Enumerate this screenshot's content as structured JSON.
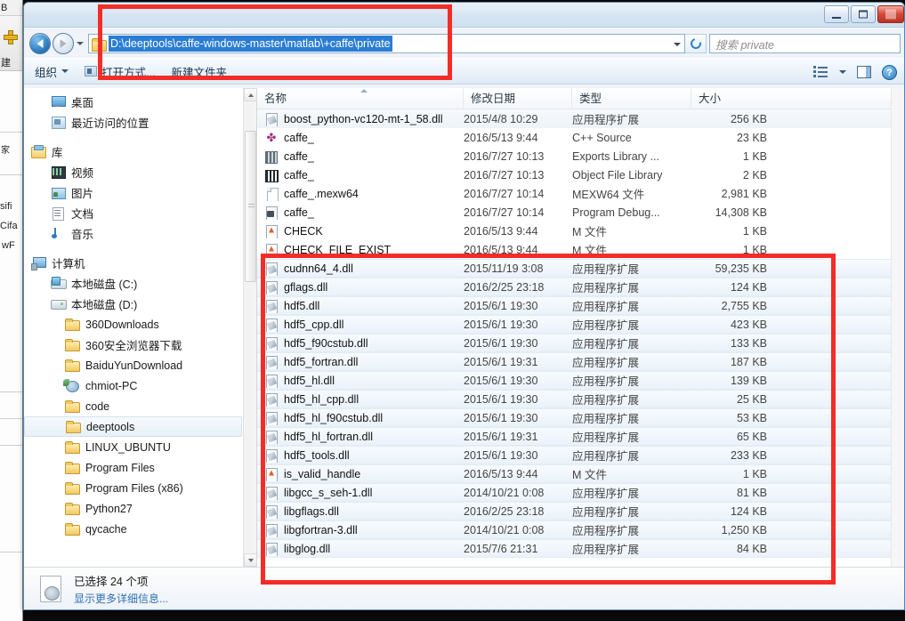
{
  "window": {
    "controls": {
      "minimize": "minimize-button",
      "maximize": "maximize-button",
      "close": "close-button"
    }
  },
  "address": {
    "path": "D:\\deeptools\\caffe-windows-master\\matlab\\+caffe\\private",
    "back_label": "后退",
    "forward_label": "前进",
    "refresh_label": "刷新"
  },
  "search": {
    "placeholder": "搜索 private"
  },
  "toolbar": {
    "organize": "组织",
    "open_with": "打开方式...",
    "new_folder": "新建文件夹",
    "help_glyph": "?"
  },
  "sidebar": {
    "items": [
      {
        "label": "桌面",
        "icon": "desktop-icon",
        "indent": 1,
        "selected": false
      },
      {
        "label": "最近访问的位置",
        "icon": "recent-icon",
        "indent": 1,
        "selected": false
      },
      {
        "label": "库",
        "icon": "library-icon",
        "indent": 0,
        "selected": false
      },
      {
        "label": "视频",
        "icon": "video-icon",
        "indent": 1,
        "selected": false
      },
      {
        "label": "图片",
        "icon": "picture-icon",
        "indent": 1,
        "selected": false
      },
      {
        "label": "文档",
        "icon": "document-icon",
        "indent": 1,
        "selected": false
      },
      {
        "label": "音乐",
        "icon": "music-icon",
        "indent": 1,
        "selected": false
      },
      {
        "label": "计算机",
        "icon": "computer-icon",
        "indent": 0,
        "selected": false
      },
      {
        "label": "本地磁盘 (C:)",
        "icon": "drive-c-icon",
        "indent": 1,
        "selected": false
      },
      {
        "label": "本地磁盘 (D:)",
        "icon": "drive-icon",
        "indent": 1,
        "selected": false
      },
      {
        "label": "360Downloads",
        "icon": "folder-icon",
        "indent": 2,
        "selected": false
      },
      {
        "label": "360安全浏览器下载",
        "icon": "folder-icon",
        "indent": 2,
        "selected": false
      },
      {
        "label": "BaiduYunDownload",
        "icon": "folder-icon",
        "indent": 2,
        "selected": false
      },
      {
        "label": "chmiot-PC",
        "icon": "network-icon",
        "indent": 2,
        "selected": false
      },
      {
        "label": "code",
        "icon": "folder-icon",
        "indent": 2,
        "selected": false
      },
      {
        "label": "deeptools",
        "icon": "folder-icon",
        "indent": 2,
        "selected": true
      },
      {
        "label": "LINUX_UBUNTU",
        "icon": "folder-icon",
        "indent": 2,
        "selected": false
      },
      {
        "label": "Program Files",
        "icon": "folder-icon",
        "indent": 2,
        "selected": false
      },
      {
        "label": "Program Files (x86)",
        "icon": "folder-icon",
        "indent": 2,
        "selected": false
      },
      {
        "label": "Python27",
        "icon": "folder-icon",
        "indent": 2,
        "selected": false
      },
      {
        "label": "qycache",
        "icon": "folder-icon",
        "indent": 2,
        "selected": false
      }
    ]
  },
  "filelist": {
    "columns": [
      "名称",
      "修改日期",
      "类型",
      "大小"
    ],
    "sorted_by": "名称",
    "rows": [
      {
        "name": "boost_python-vc120-mt-1_58.dll",
        "date": "2015/4/8 10:29",
        "type": "应用程序扩展",
        "size": "256 KB",
        "icon": "dll-icon",
        "selected": false
      },
      {
        "name": "caffe_",
        "date": "2016/5/13 9:44",
        "type": "C++ Source",
        "size": "23 KB",
        "icon": "cpp-source-icon",
        "selected": false
      },
      {
        "name": "caffe_",
        "date": "2016/7/27 10:13",
        "type": "Exports Library ...",
        "size": "1 KB",
        "icon": "exports-library-icon",
        "selected": false
      },
      {
        "name": "caffe_",
        "date": "2016/7/27 10:13",
        "type": "Object File Library",
        "size": "2 KB",
        "icon": "object-file-icon",
        "selected": false
      },
      {
        "name": "caffe_.mexw64",
        "date": "2016/7/27 10:14",
        "type": "MEXW64 文件",
        "size": "2,981 KB",
        "icon": "plain-file-icon",
        "selected": false
      },
      {
        "name": "caffe_",
        "date": "2016/7/27 10:14",
        "type": "Program Debug...",
        "size": "14,308 KB",
        "icon": "pdb-icon",
        "selected": false
      },
      {
        "name": "CHECK",
        "date": "2016/5/13 9:44",
        "type": "M 文件",
        "size": "1 KB",
        "icon": "matlab-m-icon",
        "selected": false
      },
      {
        "name": "CHECK_FILE_EXIST",
        "date": "2016/5/13 9:44",
        "type": "M 文件",
        "size": "1 KB",
        "icon": "matlab-m-icon",
        "selected": false
      },
      {
        "name": "cudnn64_4.dll",
        "date": "2015/11/19 3:08",
        "type": "应用程序扩展",
        "size": "59,235 KB",
        "icon": "dll-icon",
        "selected": true
      },
      {
        "name": "gflags.dll",
        "date": "2016/2/25 23:18",
        "type": "应用程序扩展",
        "size": "124 KB",
        "icon": "dll-icon",
        "selected": true
      },
      {
        "name": "hdf5.dll",
        "date": "2015/6/1 19:30",
        "type": "应用程序扩展",
        "size": "2,755 KB",
        "icon": "dll-icon",
        "selected": true
      },
      {
        "name": "hdf5_cpp.dll",
        "date": "2015/6/1 19:30",
        "type": "应用程序扩展",
        "size": "423 KB",
        "icon": "dll-icon",
        "selected": true
      },
      {
        "name": "hdf5_f90cstub.dll",
        "date": "2015/6/1 19:30",
        "type": "应用程序扩展",
        "size": "133 KB",
        "icon": "dll-icon",
        "selected": true
      },
      {
        "name": "hdf5_fortran.dll",
        "date": "2015/6/1 19:31",
        "type": "应用程序扩展",
        "size": "187 KB",
        "icon": "dll-icon",
        "selected": true
      },
      {
        "name": "hdf5_hl.dll",
        "date": "2015/6/1 19:30",
        "type": "应用程序扩展",
        "size": "139 KB",
        "icon": "dll-icon",
        "selected": true
      },
      {
        "name": "hdf5_hl_cpp.dll",
        "date": "2015/6/1 19:30",
        "type": "应用程序扩展",
        "size": "25 KB",
        "icon": "dll-icon",
        "selected": true
      },
      {
        "name": "hdf5_hl_f90cstub.dll",
        "date": "2015/6/1 19:30",
        "type": "应用程序扩展",
        "size": "53 KB",
        "icon": "dll-icon",
        "selected": true
      },
      {
        "name": "hdf5_hl_fortran.dll",
        "date": "2015/6/1 19:31",
        "type": "应用程序扩展",
        "size": "65 KB",
        "icon": "dll-icon",
        "selected": true
      },
      {
        "name": "hdf5_tools.dll",
        "date": "2015/6/1 19:30",
        "type": "应用程序扩展",
        "size": "233 KB",
        "icon": "dll-icon",
        "selected": true
      },
      {
        "name": "is_valid_handle",
        "date": "2016/5/13 9:44",
        "type": "M 文件",
        "size": "1 KB",
        "icon": "matlab-m-icon",
        "selected": true
      },
      {
        "name": "libgcc_s_seh-1.dll",
        "date": "2014/10/21 0:08",
        "type": "应用程序扩展",
        "size": "81 KB",
        "icon": "dll-icon",
        "selected": true
      },
      {
        "name": "libgflags.dll",
        "date": "2016/2/25 23:18",
        "type": "应用程序扩展",
        "size": "124 KB",
        "icon": "dll-icon",
        "selected": true
      },
      {
        "name": "libgfortran-3.dll",
        "date": "2014/10/21 0:08",
        "type": "应用程序扩展",
        "size": "1,250 KB",
        "icon": "dll-icon",
        "selected": true
      },
      {
        "name": "libglog.dll",
        "date": "2015/7/6 21:31",
        "type": "应用程序扩展",
        "size": "84 KB",
        "icon": "dll-icon",
        "selected": true
      }
    ]
  },
  "status": {
    "selected_text": "已选择 24 个项",
    "details_link": "显示更多详细信息..."
  },
  "background_window": {
    "fragments": [
      "B",
      "建",
      "家",
      "sifi",
      "Cifa",
      "wF"
    ]
  },
  "annotations": {
    "color": "#f42c28",
    "regions": [
      "address-bar-highlight",
      "selected-files-highlight"
    ]
  }
}
